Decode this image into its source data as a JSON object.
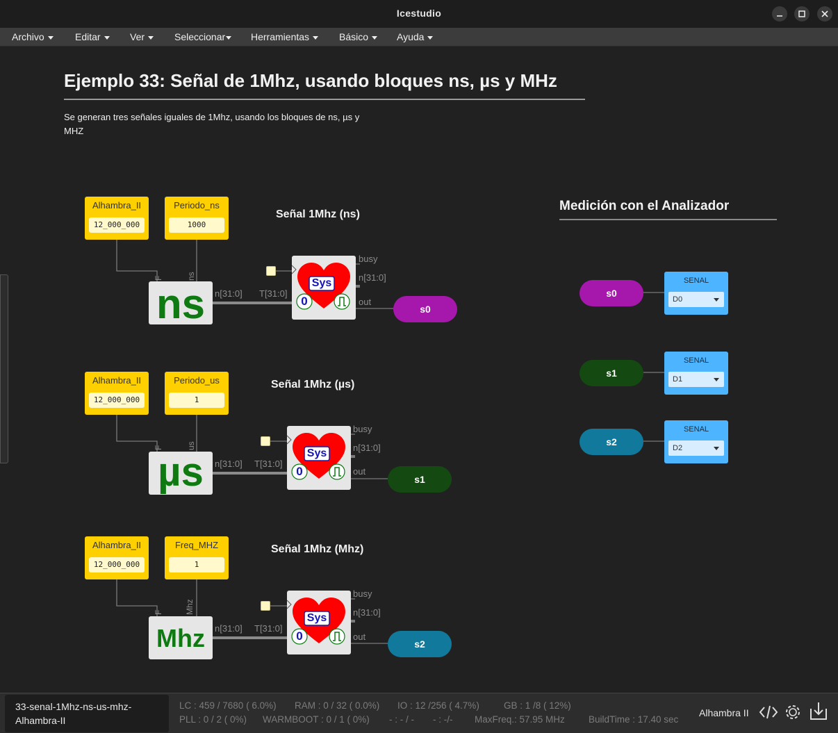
{
  "window": {
    "title": "Icestudio"
  },
  "menu": [
    {
      "label": "Archivo"
    },
    {
      "label": "Editar"
    },
    {
      "label": "Ver"
    },
    {
      "label": "Seleccionar"
    },
    {
      "label": "Herramientas"
    },
    {
      "label": "Básico"
    },
    {
      "label": "Ayuda"
    }
  ],
  "canvas": {
    "title": "Ejemplo 33: Señal de 1Mhz, usando bloques ns, µs y MHz",
    "description": "Se generan tres señales iguales de 1Mhz, usando los bloques de ns, µs y MHZ",
    "analyzer_title": "Medición con el Analizador",
    "sections": [
      {
        "title": "Señal 1Mhz (ns)",
        "const1": {
          "name": "Alhambra_II",
          "value": "12_000_000"
        },
        "const2": {
          "name": "Periodo_ns",
          "value": "1000"
        },
        "converter": {
          "label": "ns",
          "port_f": "F",
          "port_in": "ns"
        },
        "wire_in": "n[31:0]",
        "wire_out": "T[31:0]",
        "sys": {
          "label": "Sys",
          "zero": "0",
          "busy": "busy",
          "n": "n[31:0]",
          "out": "out"
        },
        "output": {
          "label": "s0",
          "color": "#a617ac"
        }
      },
      {
        "title": "Señal 1Mhz (µs)",
        "const1": {
          "name": "Alhambra_II",
          "value": "12_000_000"
        },
        "const2": {
          "name": "Periodo_us",
          "value": "1"
        },
        "converter": {
          "label": "µs",
          "port_f": "F",
          "port_in": "us"
        },
        "wire_in": "n[31:0]",
        "wire_out": "T[31:0]",
        "sys": {
          "label": "Sys",
          "zero": "0",
          "busy": "busy",
          "n": "n[31:0]",
          "out": "out"
        },
        "output": {
          "label": "s1",
          "color": "#144a12"
        }
      },
      {
        "title": "Señal 1Mhz (Mhz)",
        "const1": {
          "name": "Alhambra_II",
          "value": "12_000_000"
        },
        "const2": {
          "name": "Freq_MHZ",
          "value": "1"
        },
        "converter": {
          "label": "Mhz",
          "port_f": "F",
          "port_in": "Mhz"
        },
        "wire_in": "n[31:0]",
        "wire_out": "T[31:0]",
        "sys": {
          "label": "Sys",
          "zero": "0",
          "busy": "busy",
          "n": "n[31:0]",
          "out": "out"
        },
        "output": {
          "label": "s2",
          "color": "#117a9c"
        }
      }
    ],
    "analyzer": [
      {
        "input": "s0",
        "color": "#a617ac",
        "block": "SENAL",
        "channel": "D0"
      },
      {
        "input": "s1",
        "color": "#144a12",
        "block": "SENAL",
        "channel": "D1"
      },
      {
        "input": "s2",
        "color": "#117a9c",
        "block": "SENAL",
        "channel": "D2"
      }
    ]
  },
  "statusbar": {
    "file_line1": "33-senal-1Mhz-ns-us-mhz-",
    "file_line2": "Alhambra-II",
    "lc": "LC : 459 / 7680 ( 6.0%)",
    "ram": "RAM : 0 / 32 ( 0.0%)",
    "io": "IO :  12 /256  ( 4.7%)",
    "gb": "GB :  1 /8  ( 12%)",
    "pll": "PLL : 0 / 2 ( 0%)",
    "warmboot": "WARMBOOT : 0 / 1 ( 0%)",
    "dash1": "- : - / -",
    "dash2": "- :  -/-",
    "maxfreq": "MaxFreq.:  57.95 MHz",
    "buildtime": "BuildTime :  17.40 sec",
    "board": "Alhambra II",
    "icons": [
      "code-icon",
      "settings-gear-icon",
      "upload-icon"
    ]
  }
}
